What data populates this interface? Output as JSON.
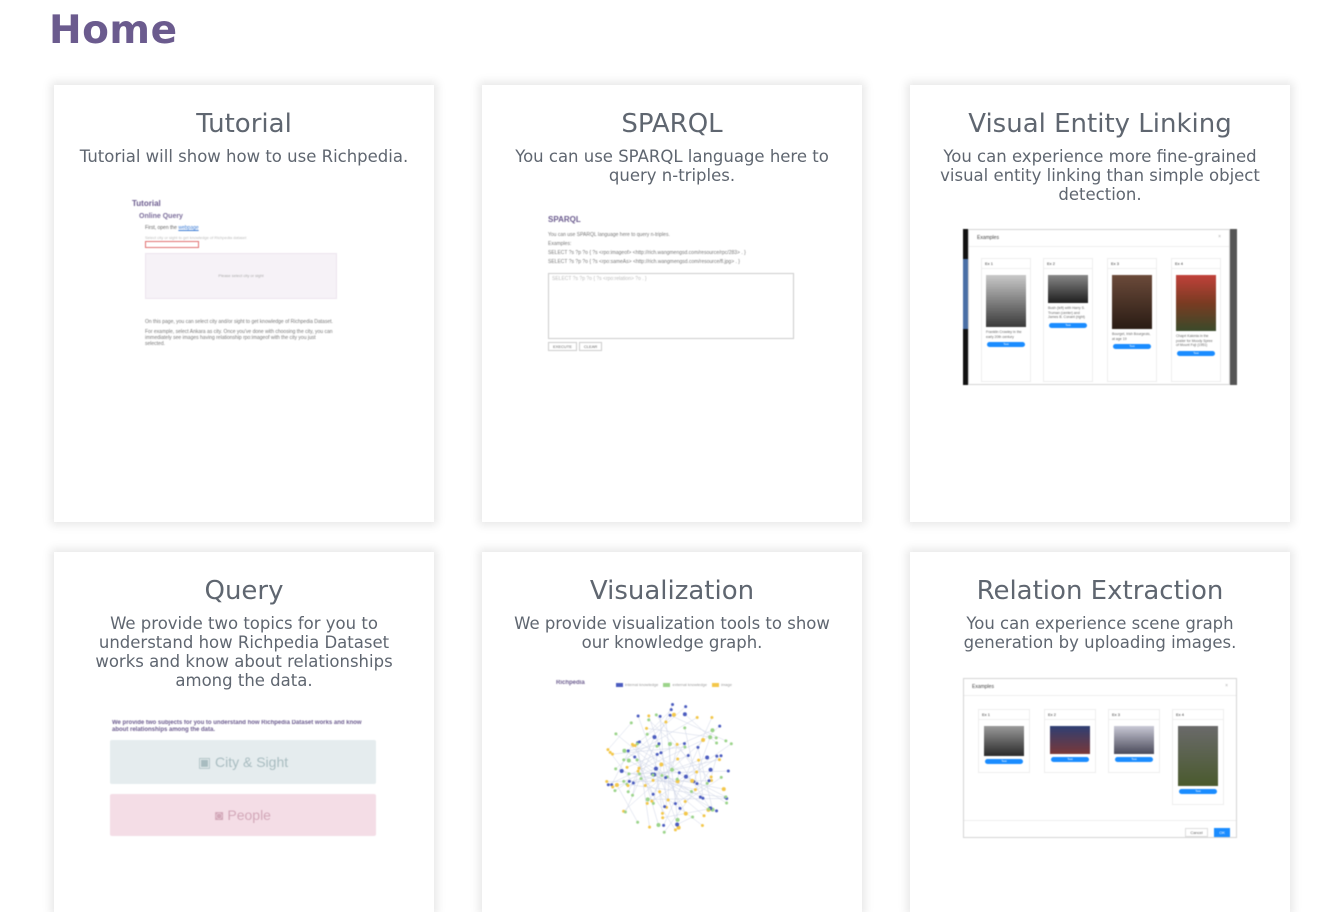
{
  "page": {
    "title": "Home"
  },
  "cards": [
    {
      "title": "Tutorial",
      "desc": "Tutorial will show how to use Richpedia."
    },
    {
      "title": "SPARQL",
      "desc": "You can use SPARQL language here to query n-triples."
    },
    {
      "title": "Visual Entity Linking",
      "desc": "You can experience more fine-grained visual entity linking than simple object detection."
    },
    {
      "title": "Query",
      "desc": "We provide two topics for you to understand how Richpedia Dataset works and know about relationships among the data."
    },
    {
      "title": "Visualization",
      "desc": "We provide visualization tools to show our knowledge graph."
    },
    {
      "title": "Relation Extraction",
      "desc": "You can experience scene graph generation by uploading images."
    }
  ],
  "tutorial_preview": {
    "heading": "Tutorial",
    "subheading": "Online Query",
    "step_text": "First, open the",
    "step_link": "webpage",
    "hint": "Select city or sight to get knowledge of Richpedia dataset",
    "box_text": "Please select city or sight",
    "para1": "On this page, you can select city and/or sight to get knowledge of Richpedia Dataset.",
    "para2": "For example, select Ankara as city. Once you've done with choosing the city, you can immediately see images having relationship rpo:imageof with the city you just selected."
  },
  "sparql_preview": {
    "heading": "SPARQL",
    "intro": "You can use SPARQL language here to query n-triples.",
    "examples_label": "Examples:",
    "example1": "SELECT ?s ?p ?o { ?s <rpo:imageof> <http://rich.wangmengsd.com/resource/rpc/283> . }",
    "example2": "SELECT ?s ?p ?o { ?s <rpo:sameAs> <http://rich.wangmengsd.com/resource/fl.jpg> . }",
    "textarea_placeholder": "SELECT ?s ?p ?o { ?s <rpo:relation> ?o . }",
    "execute_label": "EXECUTE",
    "clear_label": "CLEAR"
  },
  "vel_preview": {
    "modal_title": "Examples",
    "examples": [
      {
        "label": "Ex 1",
        "caption": "Franklin Crowley in the early 20th century",
        "button": "Test"
      },
      {
        "label": "Ex 2",
        "caption": "Bush (left) with Harry S. Truman (center) and James B. Conant (right)",
        "button": "Test"
      },
      {
        "label": "Ex 3",
        "caption": "Bourget, Irish Bourgeois, at age 19",
        "button": "Test"
      },
      {
        "label": "Ex 4",
        "caption": "Chapri Kakmia in the poster for Moody Spree of Mount Fuji (1951)",
        "button": "Test"
      }
    ]
  },
  "query_preview": {
    "heading": "We provide two subjects for you to understand how Richpedia Dataset works and know about relationships among the data.",
    "button1": "City & Sight",
    "button2": "People",
    "button1_icon": "image-icon",
    "button2_icon": "person-badge-icon"
  },
  "vis_preview": {
    "brand": "Richpedia",
    "legend": [
      "internal knowledge",
      "external knowledge",
      "image"
    ],
    "legend_colors": [
      "#4a5bbf",
      "#9bd48a",
      "#f3c74a"
    ]
  },
  "re_preview": {
    "modal_title": "Examples",
    "examples": [
      {
        "label": "Ex 1",
        "button": "Test"
      },
      {
        "label": "Ex 2",
        "button": "Test"
      },
      {
        "label": "Ex 3",
        "button": "Test"
      },
      {
        "label": "Ex 4",
        "button": "Test"
      }
    ],
    "cancel_label": "Cancel",
    "ok_label": "OK"
  },
  "colors": {
    "title": "#6b5b8e",
    "text": "#5f6670",
    "accent": "#1a8cff"
  }
}
